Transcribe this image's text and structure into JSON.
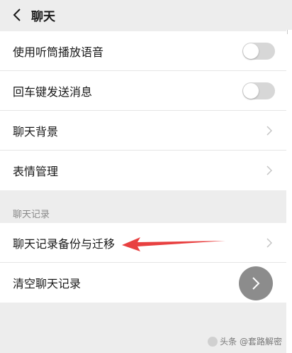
{
  "header": {
    "title": "聊天"
  },
  "settings": [
    {
      "label": "使用听筒播放语音",
      "control": "toggle",
      "enabled": false
    },
    {
      "label": "回车键发送消息",
      "control": "toggle",
      "enabled": false
    },
    {
      "label": "聊天背景",
      "control": "chevron"
    },
    {
      "label": "表情管理",
      "control": "chevron"
    }
  ],
  "chat_history": {
    "section_title": "聊天记录",
    "items": [
      {
        "label": "聊天记录备份与迁移",
        "control": "chevron"
      },
      {
        "label": "清空聊天记录",
        "control": "chevron"
      }
    ]
  },
  "annotation": {
    "arrow_color": "#e84040"
  },
  "watermark": {
    "text": "头条 @套路解密"
  },
  "colors": {
    "background": "#ededed",
    "toggle_off": "#d7d7d7",
    "float_button": "#8c8c8c"
  }
}
